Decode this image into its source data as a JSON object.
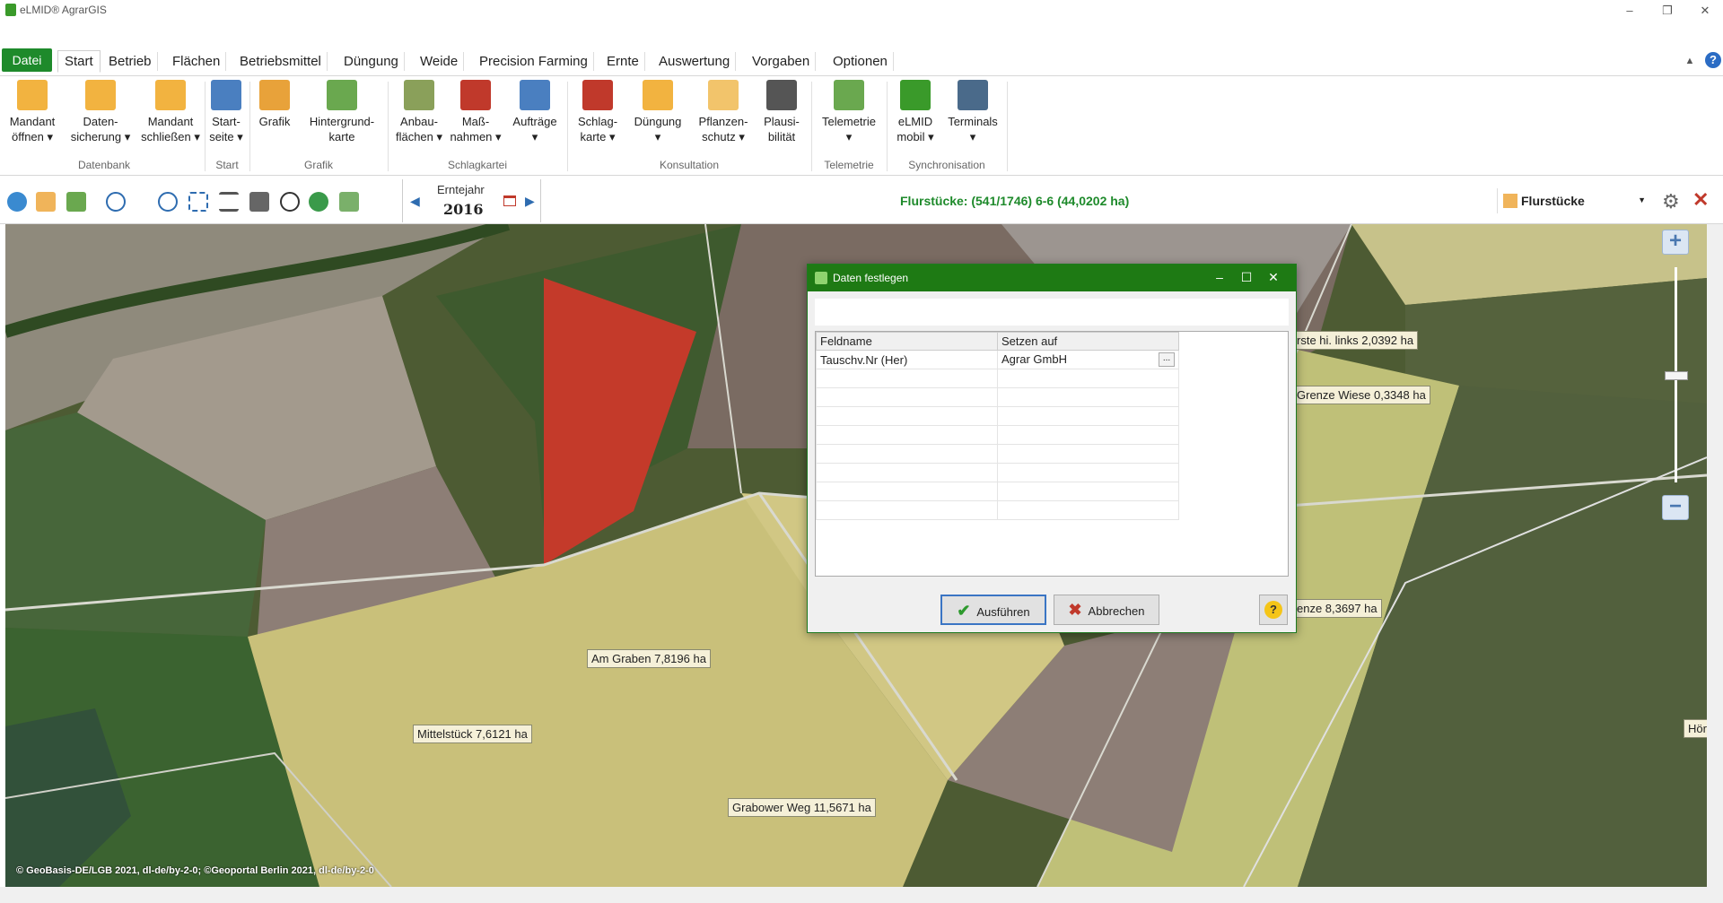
{
  "window": {
    "title": "eLMID® AgrarGIS",
    "controls": [
      "–",
      "❐",
      "✕"
    ]
  },
  "menu": {
    "file_tab": "Datei",
    "tabs": [
      "Start",
      "Betrieb",
      "Flächen",
      "Betriebsmittel",
      "Düngung",
      "Weide",
      "Precision Farming",
      "Ernte",
      "Auswertung",
      "Vorgaben",
      "Optionen"
    ],
    "active_tab": "Start"
  },
  "ribbon": {
    "buttons": [
      {
        "line1": "Mandant",
        "line2": "öffnen ▾",
        "icon": "folder-open-icon",
        "color": "#f2b340"
      },
      {
        "line1": "Daten-",
        "line2": "sicherung ▾",
        "icon": "folder-save-icon",
        "color": "#f2b340"
      },
      {
        "line1": "Mandant",
        "line2": "schließen ▾",
        "icon": "folder-close-icon",
        "color": "#f2b340"
      },
      {
        "line1": "Start-",
        "line2": "seite ▾",
        "icon": "dashboard-icon",
        "color": "#4a7fc0"
      },
      {
        "line1": "Grafik",
        "line2": "",
        "icon": "map-pencil-icon",
        "color": "#e8a23a"
      },
      {
        "line1": "Hintergrund-",
        "line2": "karte",
        "icon": "background-map-icon",
        "color": "#6aa84f"
      },
      {
        "line1": "Anbau-",
        "line2": "flächen ▾",
        "icon": "cultivation-icon",
        "color": "#8aa05a"
      },
      {
        "line1": "Maß-",
        "line2": "nahmen ▾",
        "icon": "tractor-icon",
        "color": "#c0392b"
      },
      {
        "line1": "Aufträge",
        "line2": "▾",
        "icon": "calendar-icon",
        "color": "#4a7fc0"
      },
      {
        "line1": "Schlag-",
        "line2": "karte ▾",
        "icon": "field-card-icon",
        "color": "#c0392b"
      },
      {
        "line1": "Düngung",
        "line2": "▾",
        "icon": "npk-icon",
        "color": "#f2b340"
      },
      {
        "line1": "Pflanzen-",
        "line2": "schutz ▾",
        "icon": "plant-protection-icon",
        "color": "#f2c46b"
      },
      {
        "line1": "Plausi-",
        "line2": "bilität",
        "icon": "traffic-light-icon",
        "color": "#555555"
      },
      {
        "line1": "Telemetrie",
        "line2": "▾",
        "icon": "telemetry-icon",
        "color": "#6aa84f"
      },
      {
        "line1": "eLMID",
        "line2": "mobil ▾",
        "icon": "mobile-icon",
        "color": "#3a9a2a"
      },
      {
        "line1": "Terminals",
        "line2": "▾",
        "icon": "terminal-icon",
        "color": "#4a6a8a"
      }
    ],
    "groups": [
      "Datenbank",
      "Start",
      "Grafik",
      "Schlagkartei",
      "Konsultation",
      "Telemetrie",
      "Synchronisation"
    ]
  },
  "toolbar": {
    "harvest_year_label": "Erntejahr",
    "harvest_year": "2016",
    "status": "Flurstücke: (541/1746) 6-6 (44,0202 ha)",
    "layer": "Flurstücke"
  },
  "map": {
    "labels": [
      "Am Graben 7,8196 ha",
      "Mittelstück 7,6121 ha",
      "Grabower Weg 11,5671 ha",
      "rste hi. links 2,0392 ha",
      "Grenze Wiese 0,3348 ha",
      "enze 8,3697 ha",
      "Hör"
    ],
    "copyright": "© GeoBasis-DE/LGB 2021, dl-de/by-2-0; ©Geoportal Berlin 2021, dl-de/by-2-0"
  },
  "dialog": {
    "title": "Daten festlegen",
    "columns": [
      "Feldname",
      "Setzen auf"
    ],
    "rows": [
      {
        "field": "Tauschv.Nr (Her)",
        "value": "Agrar GmbH"
      }
    ],
    "ok_label": "Ausführen",
    "cancel_label": "Abbrechen",
    "help_label": "?"
  }
}
